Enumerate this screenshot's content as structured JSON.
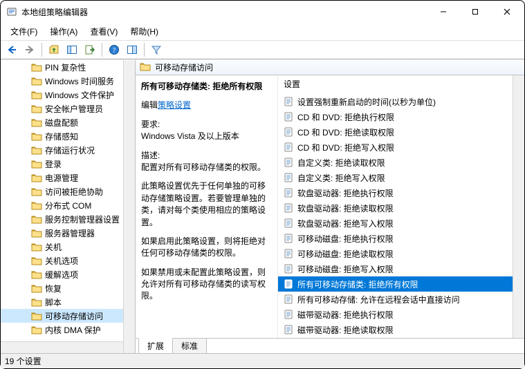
{
  "window": {
    "title": "本地组策略编辑器"
  },
  "menus": {
    "file": "文件(F)",
    "action": "操作(A)",
    "view": "查看(V)",
    "help": "帮助(H)"
  },
  "tree": {
    "items": [
      "PIN 复杂性",
      "Windows 时间服务",
      "Windows 文件保护",
      "安全帐户管理员",
      "磁盘配额",
      "存储感知",
      "存储运行状况",
      "登录",
      "电源管理",
      "访问被拒绝协助",
      "分布式 COM",
      "服务控制管理器设置",
      "服务器管理器",
      "关机",
      "关机选项",
      "缓解选项",
      "恢复",
      "脚本",
      "可移动存储访问",
      "内核 DMA 保护"
    ],
    "selected": "可移动存储访问"
  },
  "detail": {
    "header": "可移动存储访问",
    "title": "所有可移动存储类: 拒绝所有权限",
    "edit_label_prefix": "编辑",
    "edit_link": "策略设置",
    "requirements_label": "要求:",
    "requirements_text": "Windows Vista 及以上版本",
    "description_label": "描述:",
    "description_text": "配置对所有可移动存储类的权限。",
    "para2": "此策略设置优先于任何单独的可移动存储策略设置。若要管理单独的类，请对每个类使用相应的策略设置。",
    "para3": "如果启用此策略设置，则将拒绝对任何可移动存储类的权限。",
    "para4": "如果禁用或未配置此策略设置，则允许对所有可移动存储类的读写权限。"
  },
  "settings": {
    "header": "设置",
    "items": [
      "设置强制重新启动的时间(以秒为单位)",
      "CD 和 DVD: 拒绝执行权限",
      "CD 和 DVD: 拒绝读取权限",
      "CD 和 DVD: 拒绝写入权限",
      "自定义类: 拒绝读取权限",
      "自定义类: 拒绝写入权限",
      "软盘驱动器: 拒绝执行权限",
      "软盘驱动器: 拒绝读取权限",
      "软盘驱动器: 拒绝写入权限",
      "可移动磁盘: 拒绝执行权限",
      "可移动磁盘: 拒绝读取权限",
      "可移动磁盘: 拒绝写入权限",
      "所有可移动存储类: 拒绝所有权限",
      "所有可移动存储: 允许在远程会话中直接访问",
      "磁带驱动器: 拒绝执行权限",
      "磁带驱动器: 拒绝读取权限"
    ],
    "selected": "所有可移动存储类: 拒绝所有权限"
  },
  "tabs": {
    "extended": "扩展",
    "standard": "标准"
  },
  "status": {
    "text": "19 个设置"
  }
}
